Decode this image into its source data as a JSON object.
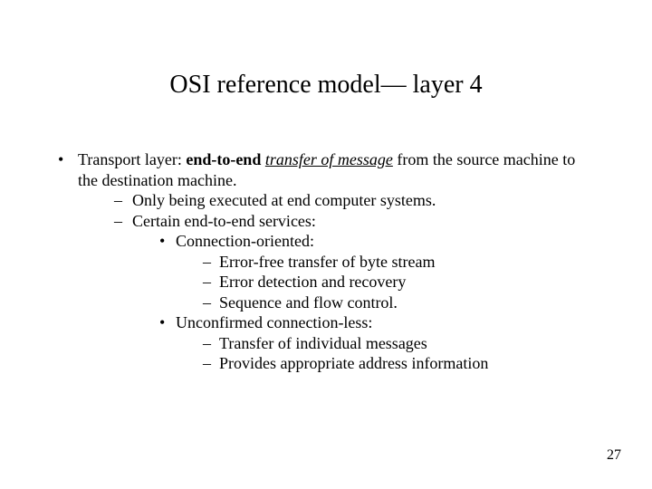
{
  "title": "OSI reference model— layer 4",
  "intro": {
    "prefix": "Transport layer:  ",
    "bold_phrase": "end-to-end",
    "space": " ",
    "ital_underline_phrase": "transfer of message",
    "suffix": " from the source machine to the destination machine."
  },
  "lvl2": {
    "a": "Only being executed at end computer systems.",
    "b": "Certain end-to-end services:"
  },
  "services": {
    "conn_oriented": "Connection-oriented:",
    "conn_oriented_items": {
      "a": "Error-free transfer of byte stream",
      "b": "Error detection and recovery",
      "c": "Sequence and flow control."
    },
    "connless": "Unconfirmed connection-less:",
    "connless_items": {
      "a": "Transfer of individual messages",
      "b": "Provides appropriate address information"
    }
  },
  "page_number": "27"
}
